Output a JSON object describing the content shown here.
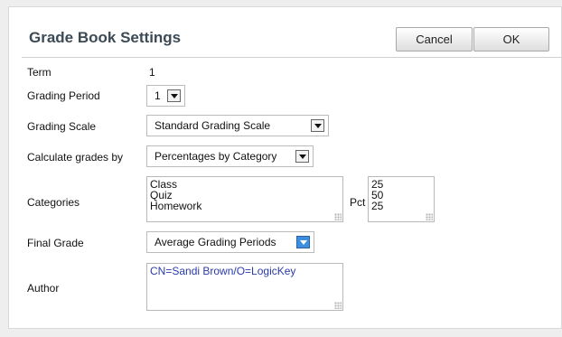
{
  "dialog": {
    "title": "Grade Book Settings",
    "cancel_label": "Cancel",
    "ok_label": "OK"
  },
  "fields": {
    "term": {
      "label": "Term",
      "value": "1"
    },
    "grading_period": {
      "label": "Grading Period",
      "value": "1"
    },
    "grading_scale": {
      "label": "Grading Scale",
      "value": "Standard Grading Scale"
    },
    "calculate_by": {
      "label": "Calculate grades by",
      "value": "Percentages by Category"
    },
    "categories": {
      "label": "Categories",
      "items": [
        "Class",
        "Quiz",
        "Homework"
      ],
      "pct_label": "Pct",
      "pcts": [
        "25",
        "50",
        "25"
      ]
    },
    "final_grade": {
      "label": "Final Grade",
      "value": "Average Grading Periods"
    },
    "author": {
      "label": "Author",
      "value": "CN=Sandi Brown/O=LogicKey",
      "color": "#2a3ba8"
    }
  },
  "icons": {
    "dropdown": "chevron-down-icon",
    "resize": "resize-grip-icon"
  }
}
